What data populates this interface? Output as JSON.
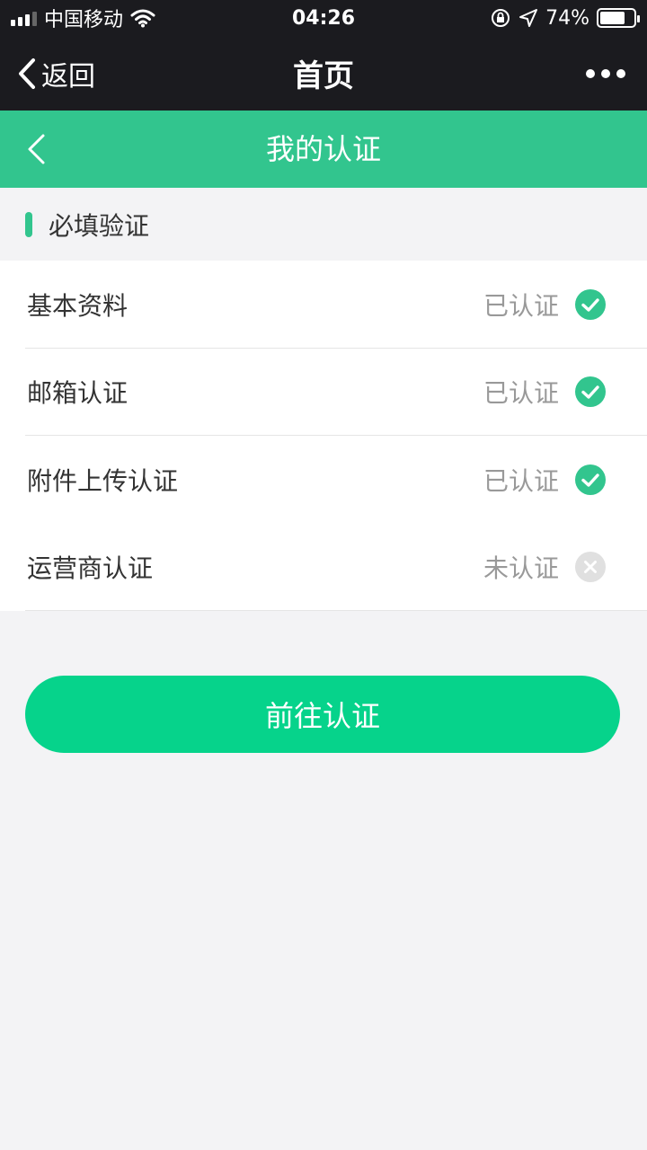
{
  "status_bar": {
    "carrier": "中国移动",
    "time": "04:26",
    "battery_percent": "74%",
    "battery_level": 0.74
  },
  "nav": {
    "back_label": "返回",
    "title": "首页"
  },
  "header": {
    "title": "我的认证"
  },
  "section": {
    "title": "必填验证"
  },
  "items": [
    {
      "label": "基本资料",
      "status": "已认证",
      "verified": true
    },
    {
      "label": "邮箱认证",
      "status": "已认证",
      "verified": true
    },
    {
      "label": "附件上传认证",
      "status": "已认证",
      "verified": true
    },
    {
      "label": "运营商认证",
      "status": "未认证",
      "verified": false
    }
  ],
  "cta": {
    "label": "前往认证"
  },
  "colors": {
    "accent": "#32c58e",
    "button": "#06d38b",
    "verified": "#32c58e",
    "unverified": "#e0e0e0"
  }
}
